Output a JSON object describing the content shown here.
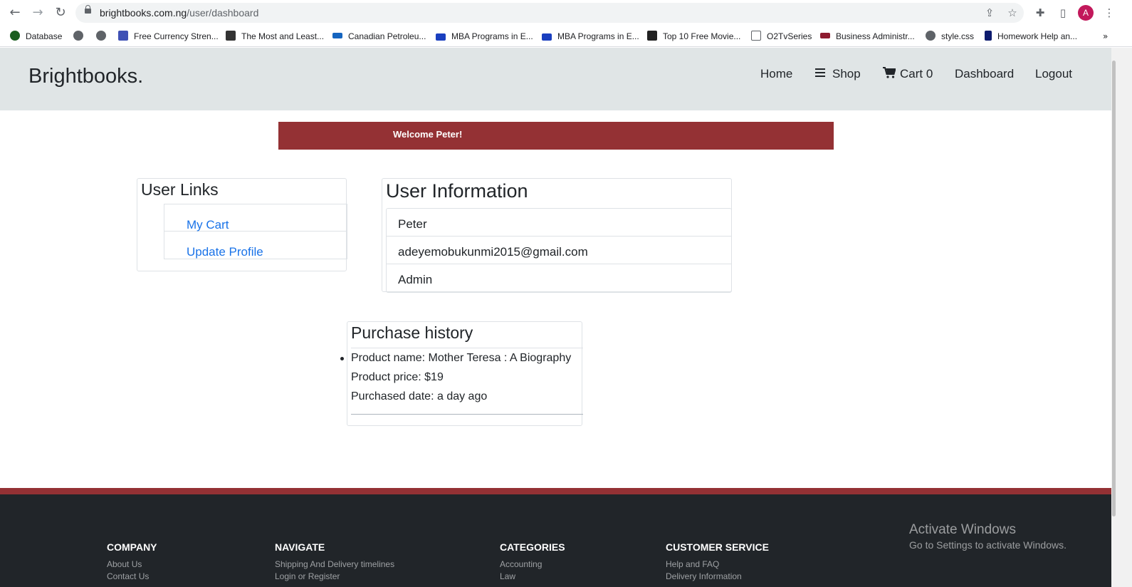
{
  "browser": {
    "url_host": "brightbooks.com.ng",
    "url_path": "/user/dashboard",
    "avatar_letter": "A",
    "bookmarks": [
      {
        "label": "Database",
        "icon": "mongodb-leaf-icon",
        "color": "#1b5e20"
      },
      {
        "label": "",
        "icon": "globe-icon",
        "color": "#5f6368"
      },
      {
        "label": "",
        "icon": "globe-icon",
        "color": "#5f6368"
      },
      {
        "label": "Free Currency Stren...",
        "icon": "chart-pulse-icon",
        "color": "#3f51b5"
      },
      {
        "label": "The Most and Least...",
        "icon": "fx-icon",
        "color": "#333333"
      },
      {
        "label": "Canadian Petroleu...",
        "icon": "wave-logo-icon",
        "color": "#1565c0"
      },
      {
        "label": "MBA Programs in E...",
        "icon": "mba-icon",
        "color": "#1a3fbf"
      },
      {
        "label": "MBA Programs in E...",
        "icon": "mba-icon",
        "color": "#1a3fbf"
      },
      {
        "label": "Top 10 Free Movie...",
        "icon": "clapper-icon",
        "color": "#222222"
      },
      {
        "label": "O2TvSeries",
        "icon": "o2tv-icon",
        "color": "#5f6368"
      },
      {
        "label": "Business Administr...",
        "icon": "flag-icon",
        "color": "#8e1b2f"
      },
      {
        "label": "style.css",
        "icon": "globe-icon",
        "color": "#5f6368"
      },
      {
        "label": "Homework Help an...",
        "icon": "letter-b-icon",
        "color": "#0d1b6e"
      }
    ]
  },
  "header": {
    "brand": "Brightbooks.",
    "nav": {
      "home": "Home",
      "shop": "Shop",
      "cart": "Cart 0",
      "dashboard": "Dashboard",
      "logout": "Logout"
    }
  },
  "welcome": "Welcome Peter!",
  "user_links": {
    "title": "User Links",
    "items": [
      "My Cart",
      "Update Profile"
    ]
  },
  "user_info": {
    "title": "User Information",
    "name": "Peter",
    "email": "adeyemobukunmi2015@gmail.com",
    "role": "Admin"
  },
  "purchase_history": {
    "title": "Purchase history",
    "product_name": "Product name: Mother Teresa : A Biography",
    "product_price": "Product price: $19",
    "purchased_date": "Purchased date: a day ago"
  },
  "footer": {
    "company": {
      "title": "COMPANY",
      "links": [
        "About Us",
        "Contact Us"
      ]
    },
    "navigate": {
      "title": "NAVIGATE",
      "links": [
        "Shipping And Delivery timelines",
        "Login or Register"
      ]
    },
    "categories": {
      "title": "CATEGORIES",
      "links": [
        "Accounting",
        "Law"
      ]
    },
    "customer_service": {
      "title": "CUSTOMER SERVICE",
      "links": [
        "Help and FAQ",
        "Delivery Information"
      ]
    }
  },
  "watermark": {
    "line1": "Activate Windows",
    "line2": "Go to Settings to activate Windows."
  },
  "colors": {
    "accent": "#943134",
    "header_bg": "#e0e5e6",
    "footer_bg": "#212529",
    "link": "#1a73e8"
  }
}
